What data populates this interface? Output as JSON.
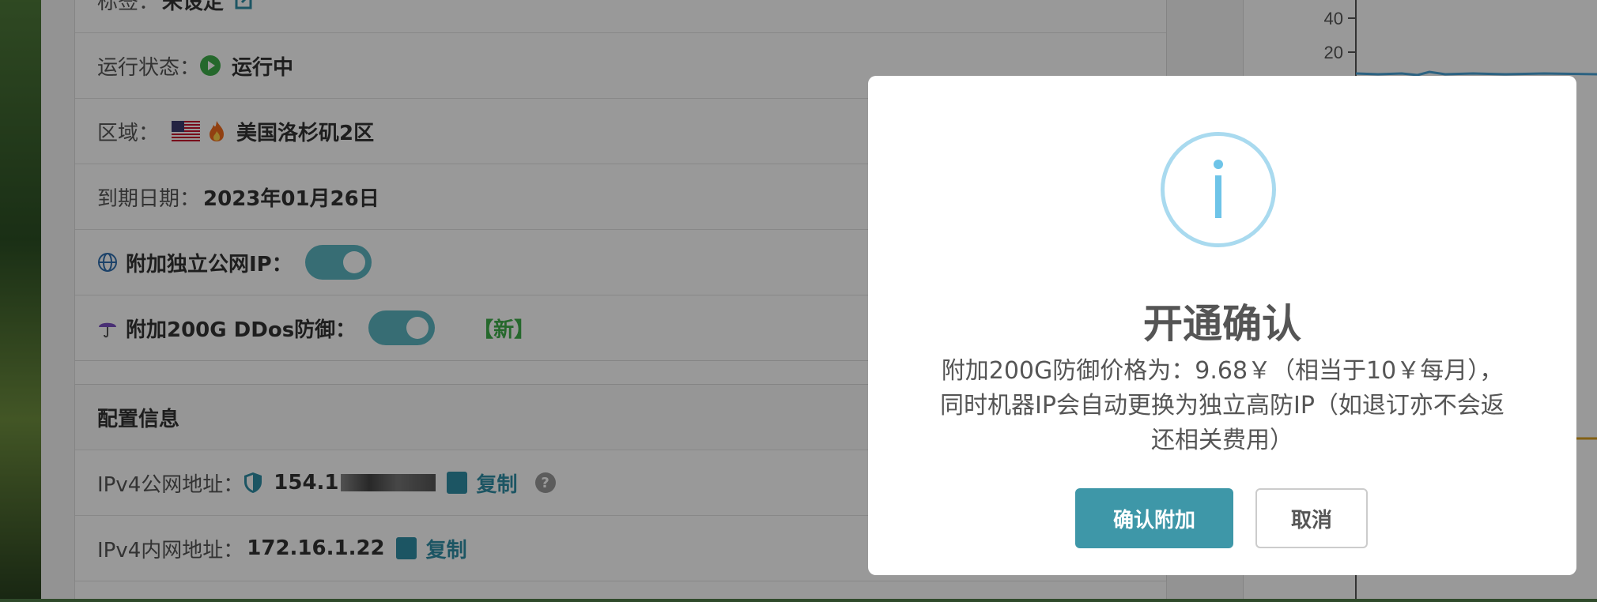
{
  "details": {
    "tag_label": "标签：",
    "tag_value": "未设定",
    "status_label": "运行状态：",
    "status_value": "运行中",
    "region_label": "区域：",
    "region_value": "美国洛杉矶2区",
    "expiry_label": "到期日期：",
    "expiry_value": "2023年01月26日",
    "ip_addon_label": "附加独立公网IP：",
    "ip_addon_enabled": true,
    "ddos_label": "附加200G DDos防御：",
    "ddos_enabled": true,
    "ddos_new_tag": "【新】"
  },
  "config": {
    "heading": "配置信息",
    "ipv4_public_label": "IPv4公网地址：",
    "ipv4_public_value": "154.1",
    "ipv4_private_label": "IPv4内网地址：",
    "ipv4_private_value": "172.16.1.22",
    "copy_label": "复制",
    "help_glyph": "?"
  },
  "chart": {
    "ticks": [
      "40",
      "20"
    ],
    "line_color": "#4aa3d8"
  },
  "dialog": {
    "title": "开通确认",
    "message": "附加200G防御价格为：9.68￥（相当于10￥每月），同时机器IP会自动更换为独立高防IP（如退订亦不会返还相关费用）",
    "confirm_label": "确认附加",
    "cancel_label": "取消",
    "icon": "info-icon",
    "accent_color": "#3e97a8"
  }
}
